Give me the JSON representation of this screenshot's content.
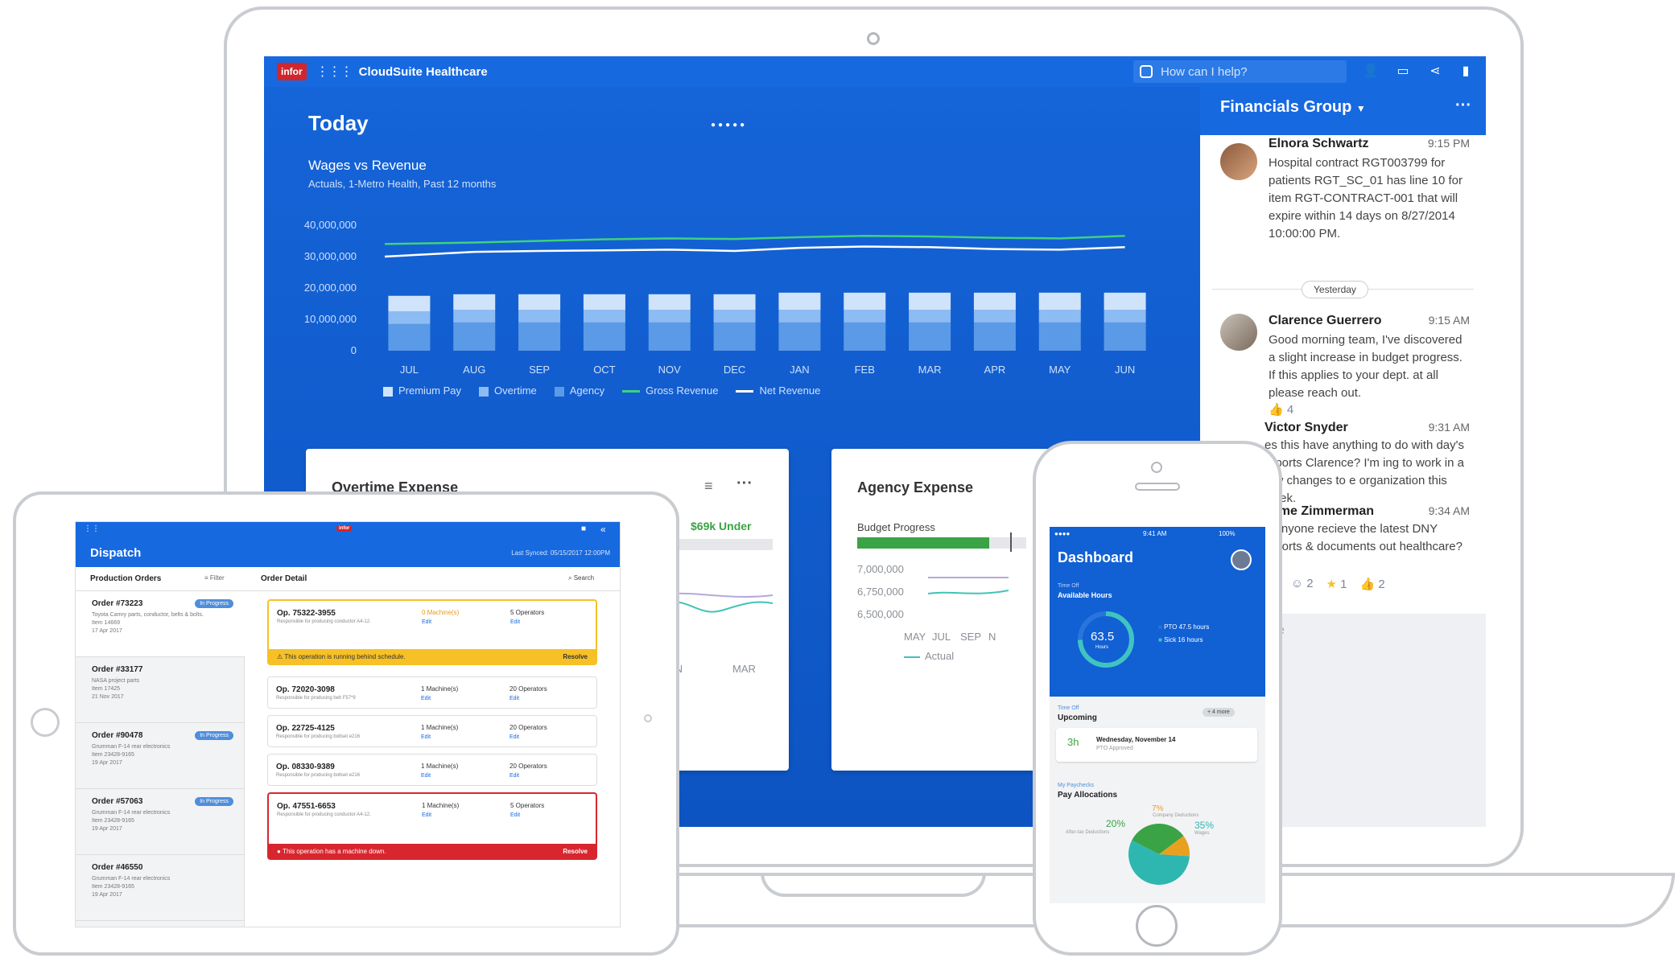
{
  "colors": {
    "brand_blue": "#1769e0",
    "dashboard_bg": "#1160d4",
    "gross_line": "#3fd17f",
    "net_line": "#ffffff",
    "under_green": "#3aa345",
    "warning_yellow": "#f6c026",
    "error_red": "#d8262f",
    "badge_blue": "#4f8edb"
  },
  "app": {
    "logo": "infor",
    "title": "CloudSuite Healthcare",
    "help_placeholder": "How can I help?",
    "icons": [
      "grid-icon",
      "user-icon",
      "chat-icon",
      "share-icon",
      "bookmark-icon"
    ]
  },
  "dashboard": {
    "title": "Today",
    "page_dots": "●●●●●"
  },
  "chart_data": {
    "type": "bar",
    "title": "Wages vs Revenue",
    "subtitle": "Actuals, 1-Metro Health, Past 12 months",
    "categories": [
      "JUL",
      "AUG",
      "SEP",
      "OCT",
      "NOV",
      "DEC",
      "JAN",
      "FEB",
      "MAR",
      "APR",
      "MAY",
      "JUN"
    ],
    "y_ticks": [
      "40,000,000",
      "30,000,000",
      "20,000,000",
      "10,000,000",
      "0"
    ],
    "ylim": [
      0,
      40000000
    ],
    "series": [
      {
        "name": "Premium Pay",
        "values": [
          5000000,
          5000000,
          5000000,
          5000000,
          5000000,
          5000000,
          5500000,
          5500000,
          5500000,
          5500000,
          5500000,
          5500000
        ]
      },
      {
        "name": "Overtime",
        "values": [
          4000000,
          4000000,
          4000000,
          4000000,
          4000000,
          4000000,
          4000000,
          4000000,
          4000000,
          4000000,
          4000000,
          4000000
        ]
      },
      {
        "name": "Agency",
        "values": [
          8500000,
          9000000,
          9000000,
          9000000,
          9000000,
          9000000,
          9000000,
          9000000,
          9000000,
          9000000,
          9000000,
          9000000
        ]
      },
      {
        "name": "Gross Revenue",
        "values": [
          34000000,
          34500000,
          35000000,
          35500000,
          35800000,
          35600000,
          36200000,
          36600000,
          36400000,
          36000000,
          35800000,
          36600000
        ]
      },
      {
        "name": "Net Revenue",
        "values": [
          30000000,
          31500000,
          31800000,
          32000000,
          32200000,
          31800000,
          32800000,
          33200000,
          33000000,
          32400000,
          32200000,
          33000000
        ]
      }
    ],
    "legend": [
      "Premium Pay",
      "Overtime",
      "Agency",
      "Gross Revenue",
      "Net Revenue"
    ],
    "legend_placement": "bottom"
  },
  "overtime_card": {
    "title": "Overtime Expense",
    "under_label": "$69k Under",
    "x_labels": [
      "AN",
      "MAR"
    ]
  },
  "agency_card": {
    "title": "Agency Expense",
    "budget_label": "Budget Progress",
    "budget_progress": 0.78,
    "y_ticks": [
      "7,000,000",
      "6,750,000",
      "6,500,000"
    ],
    "x_labels": [
      "MAY",
      "JUL",
      "SEP",
      "N"
    ],
    "legend": [
      "Actual"
    ]
  },
  "financials": {
    "group_title": "Financials Group",
    "divider": "Yesterday",
    "input_placeholder": "age",
    "messages": [
      {
        "name": "Elnora Schwartz",
        "time": "9:15 PM",
        "body": "Hospital contract RGT003799 for patients RGT_SC_01 has line 10 for item RGT-CONTRACT-001 that will expire within 14 days on 8/27/2014 10:00:00 PM."
      },
      {
        "name": "Clarence Guerrero",
        "time": "9:15 AM",
        "body": "Good morning team, I've discovered a slight increase in budget progress. If this applies to your dept. at all please reach out.",
        "likes": "4"
      },
      {
        "name": "Victor Snyder",
        "time": "9:31 AM",
        "body": "es this have anything to do with day's reports Clarence? I'm ing to work in a few changes to e organization this week."
      },
      {
        "name": "ayme Zimmerman",
        "time": "9:34 AM",
        "body": "d anyone recieve the latest DNY reports & documents out healthcare?",
        "reactions": [
          "1",
          "2",
          "1",
          "2"
        ]
      }
    ]
  },
  "tablet": {
    "title": "Dispatch",
    "last_synced": "Last Synced: 05/15/2017 12:00PM",
    "list_title": "Production Orders",
    "filter": "Filter",
    "detail_title": "Order Detail",
    "search": "Search",
    "orders": [
      {
        "id": "Order #73223",
        "desc": "Toyota Camry parts, conductor, belts & bolts.",
        "item": "Item 14669",
        "date": "17 Apr 2017",
        "badge": "In Progress"
      },
      {
        "id": "Order #33177",
        "desc": "NASA project parts",
        "item": "Item 17425",
        "date": "21 Nov 2017",
        "badge": ""
      },
      {
        "id": "Order #90478",
        "desc": "Grumman F-14 rear electronics",
        "item": "Item 23428-9165",
        "date": "19 Apr 2017",
        "badge": "In Progress"
      },
      {
        "id": "Order #57063",
        "desc": "Grumman F-14 rear electronics",
        "item": "Item 23428-9165",
        "date": "19 Apr 2017",
        "badge": "In Progress"
      },
      {
        "id": "Order #46550",
        "desc": "Grumman F-14 rear electronics",
        "item": "Item 23428-9165",
        "date": "19 Apr 2017",
        "badge": ""
      }
    ],
    "operations": [
      {
        "id": "Op. 75322-3955",
        "desc": "Responsible for producing conductor A4-12.",
        "machines": "0 Machine(s)",
        "operators": "5 Operators",
        "edit": "Edit",
        "alert": "This operation is running behind schedule.",
        "action": "Resolve"
      },
      {
        "id": "Op. 72020-3098",
        "desc": "Responsible for producing belt F57*9",
        "machines": "1 Machine(s)",
        "operators": "20 Operators",
        "edit": "Edit"
      },
      {
        "id": "Op. 22725-4125",
        "desc": "Responsible for producing boltset e216",
        "machines": "1 Machine(s)",
        "operators": "20 Operators",
        "edit": "Edit"
      },
      {
        "id": "Op. 08330-9389",
        "desc": "Responsible for producing boltset e216",
        "machines": "1 Machine(s)",
        "operators": "20 Operators",
        "edit": "Edit"
      },
      {
        "id": "Op. 47551-6653",
        "desc": "Responsible for producing conductor A4-12.",
        "machines": "1 Machine(s)",
        "operators": "5 Operators",
        "edit": "Edit",
        "alert": "This operation has a machine down.",
        "action": "Resolve"
      }
    ]
  },
  "phone": {
    "status_time": "9:41 AM",
    "battery": "100%",
    "title": "Dashboard",
    "timeoff_label": "Time Off",
    "available": "Available Hours",
    "hours_value": "63.5",
    "hours_unit": "Hours",
    "pto": "PTO 47.5 hours",
    "sick": "Sick 16 hours",
    "upcoming_label": "Time Off",
    "upcoming_title": "Upcoming",
    "more": "+ 4 more",
    "event_hours": "3h",
    "event_date": "Wednesday, November 14",
    "event_status": "PTO Approved",
    "paycheck_label": "My Paychecks",
    "paycheck_title": "Pay Allocations",
    "pie": [
      {
        "label": "After-tax Deductions",
        "pct": "20%",
        "value": 20
      },
      {
        "label": "Company Deductions",
        "pct": "7%",
        "value": 7
      },
      {
        "label": "Wages",
        "pct": "35%",
        "value": 35
      }
    ]
  }
}
